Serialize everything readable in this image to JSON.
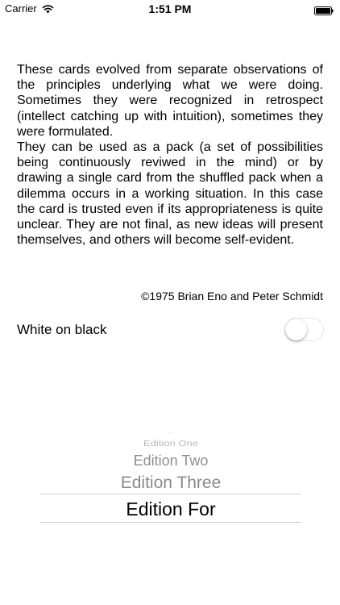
{
  "status_bar": {
    "carrier": "Carrier",
    "time": "1:51 PM"
  },
  "intro": {
    "paragraph1": "These cards evolved from separate observations of the principles underlying what we were doing. Sometimes they were recognized in retrospect (intellect catching up with intuition), sometimes they were formulated.",
    "paragraph2": "They can be used as a pack (a set of possibilities being continuously reviwed in the mind) or by drawing a single card from the shuffled pack when a dilemma occurs in a working situation. In this case the card is trusted even if its appropriateness is quite unclear. They are not final, as new ideas will present themselves, and others will become self-evident."
  },
  "copyright": "©1975 Brian Eno and Peter Schmidt",
  "setting": {
    "label": "White on black",
    "toggle_on": false
  },
  "picker": {
    "items": [
      "Edition One",
      "Edition Two",
      "Edition Three",
      "Edition For"
    ],
    "selected": "Edition For"
  },
  "icons": {
    "wifi": "wifi-icon",
    "battery": "battery-icon"
  }
}
